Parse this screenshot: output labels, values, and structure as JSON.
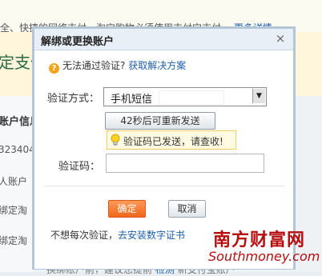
{
  "background": {
    "notice_text": "全、快捷的网络支付，淘宝购物必须使用支付宝支付，",
    "notice_link": "更多详情",
    "notice_link_suffix": "»",
    "title_fragment": "定支付",
    "section_head": "账户信息",
    "items": [
      "323404",
      "人账户",
      "绑定淘",
      "绑定淘"
    ],
    "bottom_text": "换绑账户前，建议您提前",
    "bottom_link": "检测",
    "bottom_suffix": "新支付宝账户"
  },
  "dialog": {
    "title": "解绑或更换账户",
    "close_symbol": "×",
    "warn_symbol": "?",
    "warn_text": "无法通过验证?",
    "warn_link": "获取解决方案",
    "method_label": "验证方式：",
    "method_value": "手机短信",
    "dropdown_arrow": "▼",
    "resend_label": "42秒后可重新发送",
    "tip_text": "验证码已发送，请查收!",
    "code_label": "验证码：",
    "code_value": "",
    "confirm_label": "确定",
    "cancel_label": "取消",
    "foot_text": "不想每次验证，",
    "foot_link": "去安装数字证书"
  },
  "watermark": {
    "cn": "南方财富网",
    "en": "Southmoney.com"
  },
  "colors": {
    "accent_orange": "#f0661e",
    "link_blue": "#1f5faa",
    "warn_orange": "#f3a21a",
    "watermark_red": "#b60e0e"
  }
}
